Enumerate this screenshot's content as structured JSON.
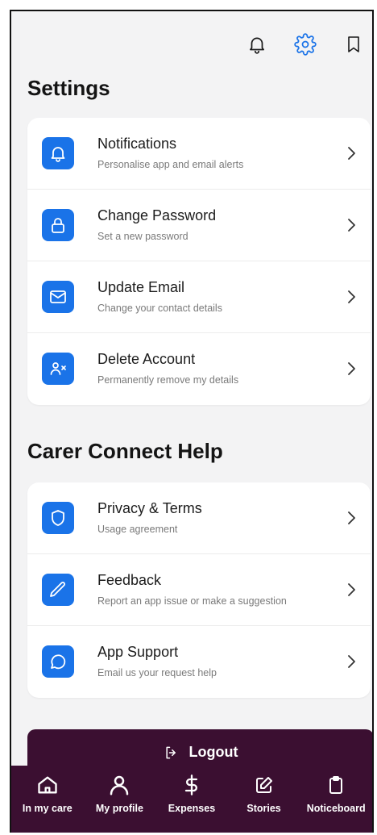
{
  "header": {
    "icons": [
      "bell-icon",
      "gear-icon",
      "bookmark-icon"
    ],
    "accent": "#1a73e8"
  },
  "settings": {
    "title": "Settings",
    "items": [
      {
        "icon": "bell-icon",
        "title": "Notifications",
        "subtitle": "Personalise app and email alerts"
      },
      {
        "icon": "lock-icon",
        "title": "Change Password",
        "subtitle": "Set a new password"
      },
      {
        "icon": "envelope-icon",
        "title": "Update Email",
        "subtitle": "Change your contact details"
      },
      {
        "icon": "user-remove-icon",
        "title": "Delete Account",
        "subtitle": "Permanently remove my details"
      }
    ]
  },
  "help": {
    "title": "Carer Connect Help",
    "items": [
      {
        "icon": "shield-icon",
        "title": "Privacy & Terms",
        "subtitle": "Usage agreement"
      },
      {
        "icon": "pencil-icon",
        "title": "Feedback",
        "subtitle": "Report an app issue or make a suggestion"
      },
      {
        "icon": "chat-bubble-icon",
        "title": "App Support",
        "subtitle": "Email us your request help"
      }
    ]
  },
  "logout": {
    "label": "Logout",
    "icon": "logout-icon"
  },
  "nav": {
    "color": "#3b0f31",
    "items": [
      {
        "icon": "home-icon",
        "label": "In my care"
      },
      {
        "icon": "person-icon",
        "label": "My profile"
      },
      {
        "icon": "dollar-icon",
        "label": "Expenses"
      },
      {
        "icon": "edit-icon",
        "label": "Stories"
      },
      {
        "icon": "clipboard-icon",
        "label": "Noticeboard"
      }
    ]
  }
}
